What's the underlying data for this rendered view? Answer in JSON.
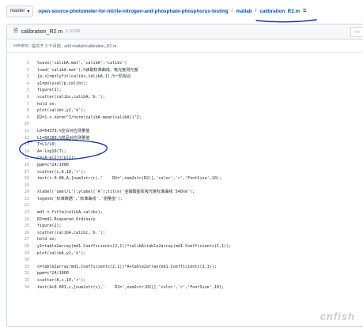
{
  "header": {
    "branch": "master",
    "repo": "open-source-photometer-for-nitrite-nitrogen-and-phosphate-phosphorus-testing",
    "folder": "matlab",
    "file": "calibration_R2.m"
  },
  "file": {
    "name": "calibration_R2.m",
    "size": "1.16 KB",
    "menu": "—"
  },
  "commit": {
    "author": "sukejing",
    "message": "提交于 3 个月前 . add matlab/calibration_R2.m."
  },
  "code": [
    {
      "n": "1",
      "t": "%save('calibA.mat','calibA','calibc')"
    },
    {
      "n": "2",
      "t": "load('calibA.mat');%读取标准曲线，吸光度测光度"
    },
    {
      "n": "3",
      "t": "[p,s]=polyfit(calibc,calibA,1);%一阶拟合"
    },
    {
      "n": "4",
      "t": "y1=polyval(p,calibc);"
    },
    {
      "n": "5",
      "t": "figure(1);"
    },
    {
      "n": "6",
      "t": "scatter(calibc,calibA,'b.');"
    },
    {
      "n": "7",
      "t": "hold on;"
    },
    {
      "n": "8",
      "t": "plot(calibc,y1,'k');"
    },
    {
      "n": "9",
      "t": "R2=1-s.normr^2/norm(calibA-mean(calibA))^2;"
    },
    {
      "n": "10",
      "t": ""
    },
    {
      "n": "11",
      "t": "L0=64379;%空白对应测量值"
    },
    {
      "n": "12",
      "t": "L1=60180;%样品对应测量值"
    },
    {
      "n": "13",
      "t": "T=L1/L0;"
    },
    {
      "n": "14",
      "t": "A=-log10(T);"
    },
    {
      "n": "15",
      "t": "c=(A-p(2))/p(2);"
    },
    {
      "n": "16",
      "t": "ppm=c*24/1000"
    },
    {
      "n": "17",
      "t": "scatter(c,A,10,'r');"
    },
    {
      "n": "18",
      "t": "text(c-0.08,A,[num2str(c),'    R2=',num2str(R2)],'color','r','FontSize',10);"
    },
    {
      "n": "19",
      "t": ""
    },
    {
      "n": "20",
      "t": "xlabel('umol/L');ylabel('A');title('亚硝酸盐氮吸光度标准曲线 540nm');"
    },
    {
      "n": "21",
      "t": "legend('标准数据','标准曲线','测量值');"
    },
    {
      "n": "22",
      "t": ""
    },
    {
      "n": "23",
      "t": "md1 = fitlm(calibA,calibc);"
    },
    {
      "n": "24",
      "t": "R2=md1.Rsquared.Ordinary"
    },
    {
      "n": "25",
      "t": "figure(2);"
    },
    {
      "n": "26",
      "t": "scatter(calibA,calibc,'b.');"
    },
    {
      "n": "27",
      "t": "hold on;"
    },
    {
      "n": "28",
      "t": "y1=table2array(md1.Coefficients(2,1))*calibA+table2array(md1.Coefficients(1,1));"
    },
    {
      "n": "29",
      "t": "plot(calibA,y1,'k');"
    },
    {
      "n": "30",
      "t": ""
    },
    {
      "n": "31",
      "t": "c=table2array(md1.Coefficients(2,1))*A+table2array(md1.Coefficients(1,1));"
    },
    {
      "n": "32",
      "t": "ppm=c*24/1000"
    },
    {
      "n": "33",
      "t": "scatter(A,c,10,'r');"
    },
    {
      "n": "34",
      "t": "text(A+0.001,c,[num2str(c),'    R2=',num2str(R2)],'color','r','FontSize',10);"
    }
  ],
  "watermark": "cnfish"
}
